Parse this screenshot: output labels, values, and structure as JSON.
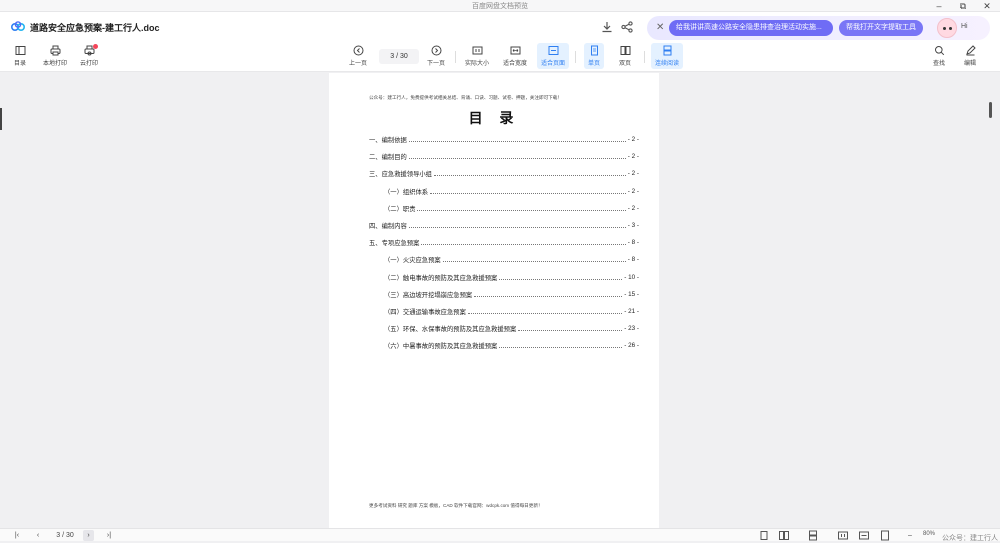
{
  "window": {
    "title": "百度网盘文档预览",
    "controls": [
      "–",
      "⧉",
      "✕"
    ]
  },
  "header": {
    "doc_title": "道路安全应急预案-建工行人.doc",
    "ai_prompt_1": "给我讲讲高速公路安全隐患排查治理活动实施...",
    "ai_prompt_2": "帮我打开文字提取工具",
    "ai_greeting": "Hi"
  },
  "toolbar": {
    "toc": "目录",
    "local_print": "本地打印",
    "cloud_print": "云打印",
    "prev_page": "上一页",
    "page_indicator": "3  /  30",
    "next_page": "下一页",
    "actual_size": "实际大小",
    "fit_width": "适合宽度",
    "fit_page": "适合页面",
    "single_page": "单页",
    "double_page": "双页",
    "continuous": "连续阅读",
    "search": "查找",
    "edit": "编辑"
  },
  "document": {
    "top_note": "公众号：建工行人，免费提供考试相关总结、背诵、口诀、习题、试卷、押题，关注即可下载！",
    "title": "目 录",
    "toc": [
      {
        "label": "一、编制依据",
        "page": "- 2 -",
        "sub": false
      },
      {
        "label": "二、编制目的",
        "page": "- 2 -",
        "sub": false
      },
      {
        "label": "三、应急救援领导小组",
        "page": "- 2 -",
        "sub": false
      },
      {
        "label": "（一）组织体系",
        "page": "- 2 -",
        "sub": true
      },
      {
        "label": "（二）职责",
        "page": "- 2 -",
        "sub": true
      },
      {
        "label": "四、编制内容",
        "page": "- 3 -",
        "sub": false
      },
      {
        "label": "五、专项应急预案",
        "page": "- 8 -",
        "sub": false
      },
      {
        "label": "（一）火灾应急预案",
        "page": "- 8 -",
        "sub": true
      },
      {
        "label": "（二）触电事故的预防及其应急救援预案",
        "page": "- 10 -",
        "sub": true
      },
      {
        "label": "（三）高边坡开挖塌崩应急预案",
        "page": "- 15 -",
        "sub": true
      },
      {
        "label": "（四）交通运输事故应急预案",
        "page": "- 21 -",
        "sub": true
      },
      {
        "label": "（五）环保、水保事故的预防及其应急救援预案",
        "page": "- 23 -",
        "sub": true
      },
      {
        "label": "（六）中暑事故的预防及其应急救援预案",
        "page": "- 26 -",
        "sub": true
      }
    ],
    "footer_note": "更多考试资料 研究 题库 方案 模板，CAD 软件下载官网：wdcpk.com 值得每日更新！"
  },
  "status": {
    "first": "|‹",
    "prev": "‹",
    "page_indicator": "3  /  30",
    "next": "›",
    "last": "›|",
    "zoom_out": "–",
    "zoom": "80%",
    "zoom_in": "+",
    "watermark": "公众号：建工行人"
  }
}
